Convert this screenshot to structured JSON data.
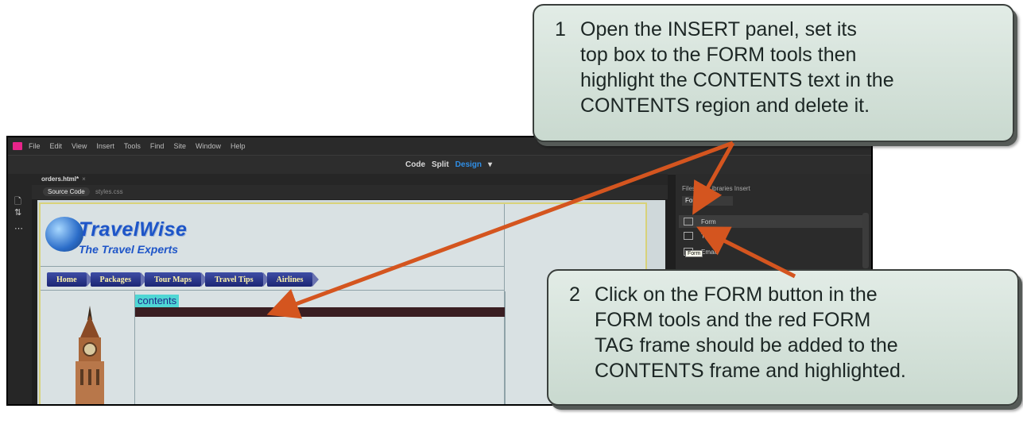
{
  "app": {
    "menu": [
      "File",
      "Edit",
      "View",
      "Insert",
      "Tools",
      "Find",
      "Site",
      "Window",
      "Help"
    ],
    "view_switch": {
      "code": "Code",
      "split": "Split",
      "design": "Design"
    }
  },
  "document": {
    "tab": "orders.html*",
    "tab_close": "×",
    "related": {
      "source": "Source Code",
      "file": "styles.css"
    }
  },
  "site": {
    "brand": "TravelWise",
    "tagline": "The Travel Experts",
    "nav": [
      "Home",
      "Packages",
      "Tour Maps",
      "Travel Tips",
      "Airlines"
    ],
    "contents_label": "contents"
  },
  "insert_panel": {
    "tabs": "Files  CC Libraries  Insert",
    "category": "Form",
    "items": [
      {
        "label": "Form",
        "icon": "form-icon"
      },
      {
        "label": "Text",
        "icon": "text-field-icon"
      },
      {
        "label": "Email",
        "icon": "email-icon"
      }
    ],
    "tooltip": "Form"
  },
  "callouts": [
    {
      "number": "1",
      "text": "Open the INSERT panel, set its\ntop box to the FORM tools then\nhighlight the CONTENTS text in the\nCONTENTS region and delete it."
    },
    {
      "number": "2",
      "text": "Click on the FORM button in the\nFORM tools and the red FORM\nTAG frame should be added to the\nCONTENTS frame and highlighted."
    }
  ],
  "colors": {
    "accent": "#2f8ee6",
    "arrow": "#d4551f",
    "highlight": "#4fd6d4"
  }
}
